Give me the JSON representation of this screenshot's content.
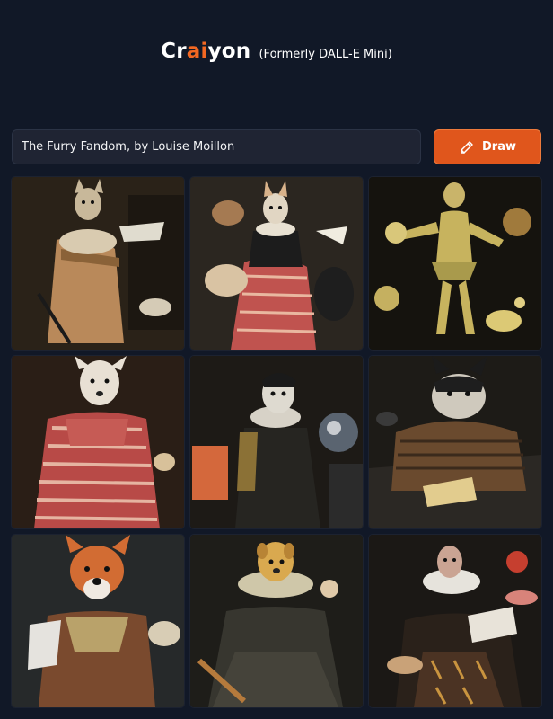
{
  "header": {
    "logo_part1": "Cr",
    "logo_accent": "ai",
    "logo_part2": "yon",
    "subtitle": "(Formerly DALL-E Mini)"
  },
  "prompt": {
    "value": "The Furry Fandom, by Louise Moillon"
  },
  "draw_button": {
    "label": "Draw",
    "icon": "pencil-icon"
  },
  "colors": {
    "background": "#111827",
    "accent": "#f26722",
    "button": "#e0561c"
  },
  "results": [
    {
      "subject": "fox woman in striped gown"
    },
    {
      "subject": "fox in red striped dress"
    },
    {
      "subject": "yellow dancing creature"
    },
    {
      "subject": "wolf in red striped dress"
    },
    {
      "subject": "dog with ruff collar"
    },
    {
      "subject": "husky in brown robe"
    },
    {
      "subject": "fox with lace collar"
    },
    {
      "subject": "dog with ruff collar and staff"
    },
    {
      "subject": "figure with ruff collar"
    }
  ]
}
